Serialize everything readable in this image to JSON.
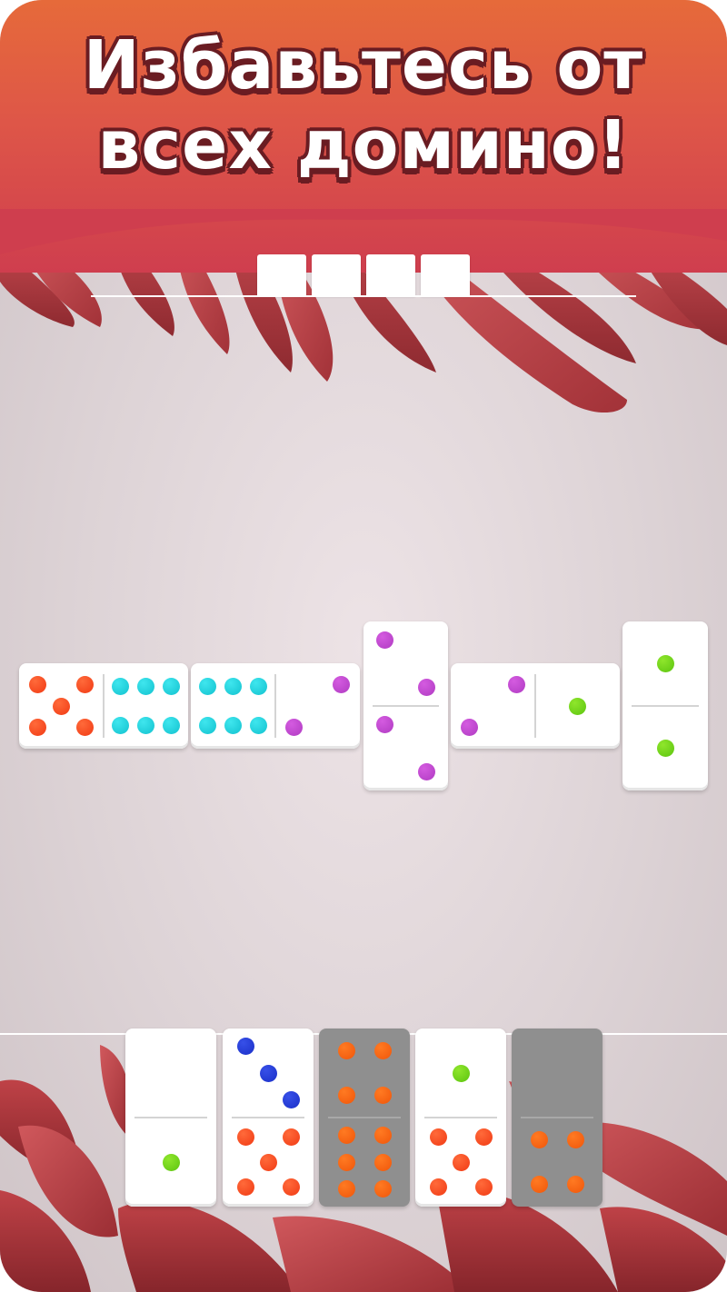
{
  "banner": {
    "headline_line1": "Избавьтесь от",
    "headline_line2": "всех домино!",
    "gradient_colors": [
      "#e66a3a",
      "#cf3e4e"
    ]
  },
  "progress": {
    "slots_total": 4,
    "slots_filled": 4
  },
  "board": {
    "tiles": [
      {
        "orientation": "horizontal",
        "ends": [
          5,
          6
        ],
        "colors": [
          "red",
          "cyan"
        ]
      },
      {
        "orientation": "horizontal",
        "ends": [
          6,
          2
        ],
        "colors": [
          "cyan",
          "purple"
        ]
      },
      {
        "orientation": "vertical",
        "ends": [
          2,
          2
        ],
        "colors": [
          "purple",
          "purple"
        ]
      },
      {
        "orientation": "horizontal",
        "ends": [
          2,
          1
        ],
        "colors": [
          "purple",
          "green"
        ]
      },
      {
        "orientation": "vertical",
        "ends": [
          1,
          1
        ],
        "colors": [
          "green",
          "green"
        ]
      }
    ]
  },
  "hand": {
    "tiles": [
      {
        "ends": [
          0,
          1
        ],
        "colors": [
          "none",
          "green"
        ],
        "playable": true
      },
      {
        "ends": [
          3,
          5
        ],
        "colors": [
          "blue",
          "red"
        ],
        "playable": true
      },
      {
        "ends": [
          4,
          6
        ],
        "colors": [
          "orange",
          "orange"
        ],
        "playable": false
      },
      {
        "ends": [
          1,
          5
        ],
        "colors": [
          "green",
          "red"
        ],
        "playable": true
      },
      {
        "ends": [
          0,
          4
        ],
        "colors": [
          "none",
          "orange"
        ],
        "playable": false
      }
    ]
  },
  "pip_colors": {
    "red": "#f13a14",
    "cyan": "#12c2cf",
    "purple": "#b03bc2",
    "green": "#5cc40f",
    "blue": "#1a2fc8",
    "orange": "#f0560a"
  }
}
